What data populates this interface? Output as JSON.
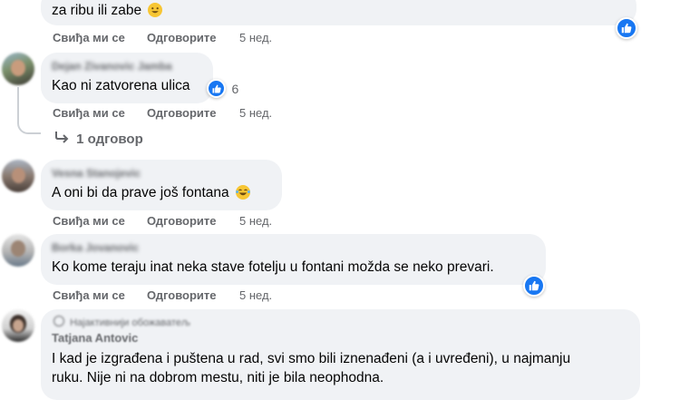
{
  "comments": [
    {
      "text": "za ribu ili zabe",
      "actions": {
        "like": "Свиђа ми се",
        "reply": "Одговорите",
        "time": "5 нед."
      }
    },
    {
      "author": "Dejan Zivanovic Jamba",
      "text": "Kao ni zatvorena ulica",
      "reactions": "6",
      "actions": {
        "like": "Свиђа ми се",
        "reply": "Одговорите",
        "time": "5 нед."
      },
      "replies_link": "1 одговор"
    },
    {
      "author": "Vesna Stanojevic",
      "text": "A oni bi da prave još fontana",
      "actions": {
        "like": "Свиђа ми се",
        "reply": "Одговорите",
        "time": "5 нед."
      }
    },
    {
      "author": "Borka Jovanovic",
      "text": "Ko kome teraju inat neka stave fotelju u fontani možda se neko prevari.",
      "actions": {
        "like": "Свиђа ми се",
        "reply": "Одговорите",
        "time": "5 нед."
      }
    },
    {
      "badge": "Најактивнији обожаватељ",
      "author": "Tatjana Antovic",
      "text_lines": [
        "I kad je izgrađena i puštena u rad, svi smo bili iznenađeni (a i uvređeni), u najmanju",
        "ruku. Nije ni na dobrom mestu, niti je bila neophodna."
      ]
    }
  ],
  "colors": {
    "bubble": "#f0f2f5",
    "like_blue": "#1877f2",
    "secondary_text": "#65676b"
  }
}
